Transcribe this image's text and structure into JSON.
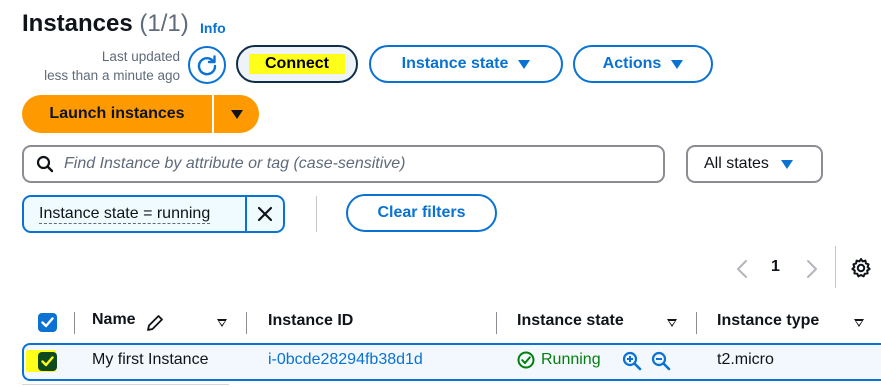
{
  "header": {
    "title": "Instances",
    "count": "(1/1)",
    "info_label": "Info",
    "last_updated_line1": "Last updated",
    "last_updated_line2": "less than a minute ago"
  },
  "toolbar": {
    "connect_label": "Connect",
    "instance_state_label": "Instance state",
    "actions_label": "Actions",
    "launch_label": "Launch instances"
  },
  "search": {
    "placeholder": "Find Instance by attribute or tag (case-sensitive)",
    "value": ""
  },
  "state_filter": {
    "selected": "All states"
  },
  "filter_token": {
    "label": "Instance state = running",
    "clear_label": "Clear filters"
  },
  "pagination": {
    "current_page": "1"
  },
  "table": {
    "columns": [
      "Name",
      "Instance ID",
      "Instance state",
      "Instance type"
    ],
    "rows": [
      {
        "selected": true,
        "name": "My first Instance",
        "instance_id": "i-0bcde28294fb38d1d",
        "state": "Running",
        "type": "t2.micro"
      }
    ]
  },
  "colors": {
    "accent": "#0972d3",
    "primary_button": "#ff9900",
    "success": "#037f0c",
    "highlight": "#ffff1a"
  },
  "icons": [
    "refresh-icon",
    "caret-down-icon",
    "search-icon",
    "close-icon",
    "chevron-left-icon",
    "chevron-right-icon",
    "settings-icon",
    "edit-icon",
    "sort-icon",
    "check-icon",
    "status-ok-icon",
    "zoom-in-icon",
    "zoom-out-icon"
  ]
}
